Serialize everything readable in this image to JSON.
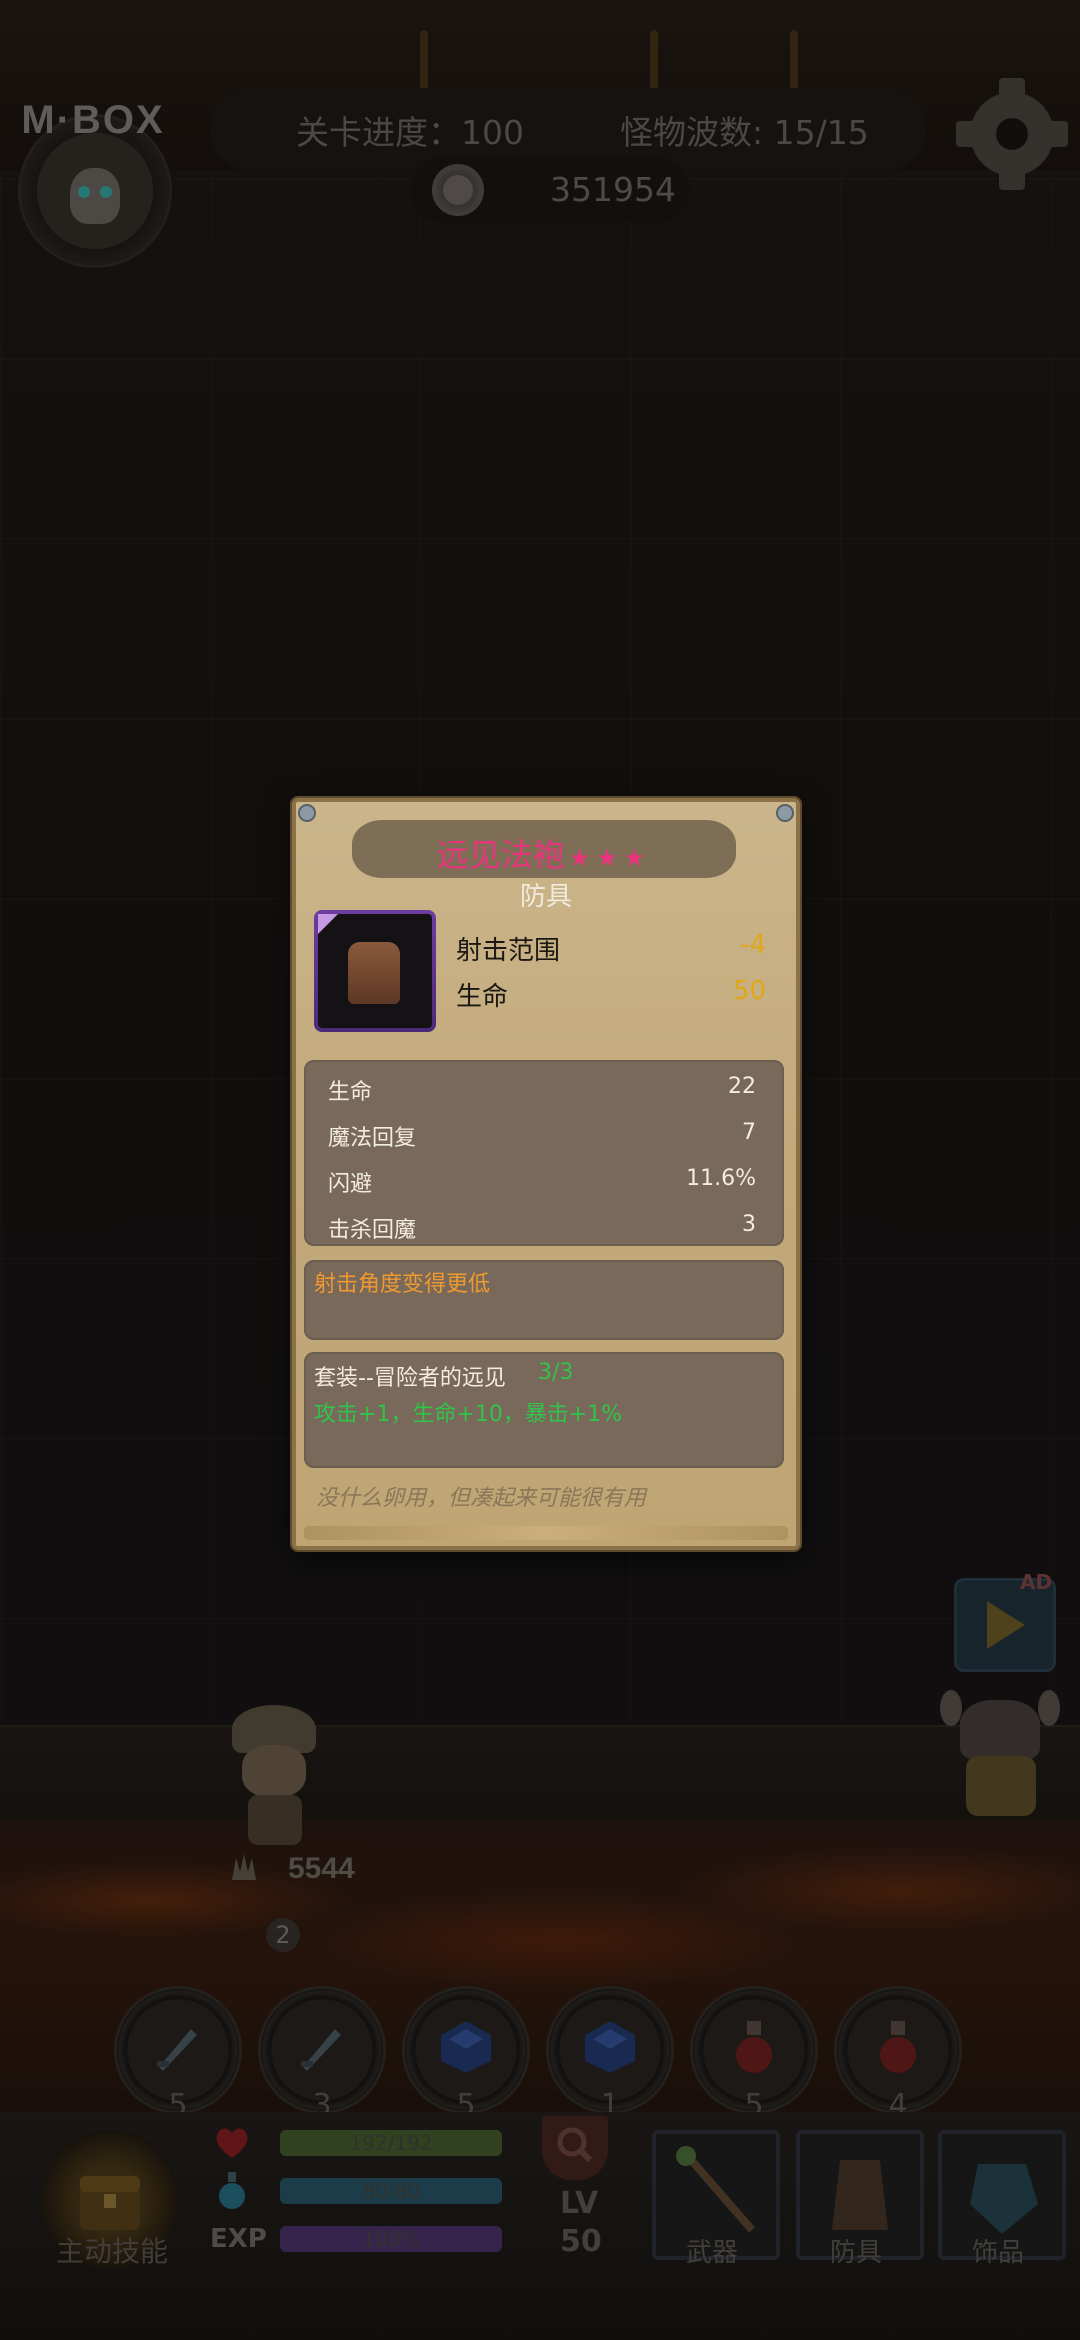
{
  "hud": {
    "logo_text": "M·BOX",
    "stage_progress": "关卡进度：100",
    "monster_wave": "怪物波数: 15/15",
    "coins": "351954"
  },
  "hero": {
    "hp": "5544",
    "badge": "2"
  },
  "ad": {
    "tag": "AD"
  },
  "skill_slots": [
    {
      "icon": "dagger-icon",
      "count": "5"
    },
    {
      "icon": "dagger-icon",
      "count": "3"
    },
    {
      "icon": "blue-gem-icon",
      "count": "5"
    },
    {
      "icon": "blue-gem-icon",
      "count": "1"
    },
    {
      "icon": "red-potion-icon",
      "count": "5"
    },
    {
      "icon": "red-potion-icon",
      "count": "4"
    }
  ],
  "bottom": {
    "active_skill_label": "主动技能",
    "exp_label": "EXP",
    "hp_bar": "192/192",
    "mp_bar": "80/80",
    "exp_bar": "100%",
    "lv_label": "LV",
    "lv_value": "50",
    "hp_fill": 1.0,
    "mp_fill": 1.0,
    "exp_fill": 1.0,
    "tabs": [
      "武器",
      "防具",
      "饰品"
    ]
  },
  "popup": {
    "name": "远见法袍",
    "stars": "★★★",
    "type": "防具",
    "main_stats": [
      {
        "label": "射击范围",
        "value": "-4"
      },
      {
        "label": "生命",
        "value": "50"
      }
    ],
    "attributes": [
      {
        "label": "生命",
        "value": "22"
      },
      {
        "label": "魔法回复",
        "value": "7"
      },
      {
        "label": "闪避",
        "value": "11.6%"
      },
      {
        "label": "击杀回魔",
        "value": "3"
      }
    ],
    "special": "射击角度变得更低",
    "set_name": "套装--冒险者的远见",
    "set_count": "3/3",
    "set_bonus": "攻击+1，生命+10，暴击+1%",
    "flavor": "没什么卵用，但凑起来可能很有用"
  },
  "colors": {
    "popup_bg": "#c2a97a",
    "title_pink": "#e8357d",
    "stat_yellow": "#e0a817",
    "set_green": "#31c34a",
    "special_orange": "#f09a2e"
  }
}
